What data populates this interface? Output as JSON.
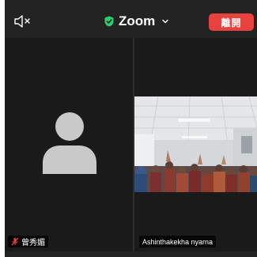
{
  "header": {
    "title": "Zoom",
    "leave_label": "離開",
    "icons": {
      "speaker": "speaker-muted-icon",
      "security": "shield-check-icon",
      "menu": "chevron-down-icon"
    },
    "colors": {
      "security": "#2ecc71",
      "leave": "#e8423f"
    }
  },
  "participants": [
    {
      "name": "曾秀媚",
      "muted": true,
      "video_on": false,
      "avatar": "person-silhouette-icon"
    },
    {
      "name": "Ashinthakekha nyarna",
      "muted": false,
      "video_on": true
    }
  ],
  "colors": {
    "background": "#232323",
    "tile": "#1a1a1a",
    "muted_mic": "#e8423f"
  }
}
